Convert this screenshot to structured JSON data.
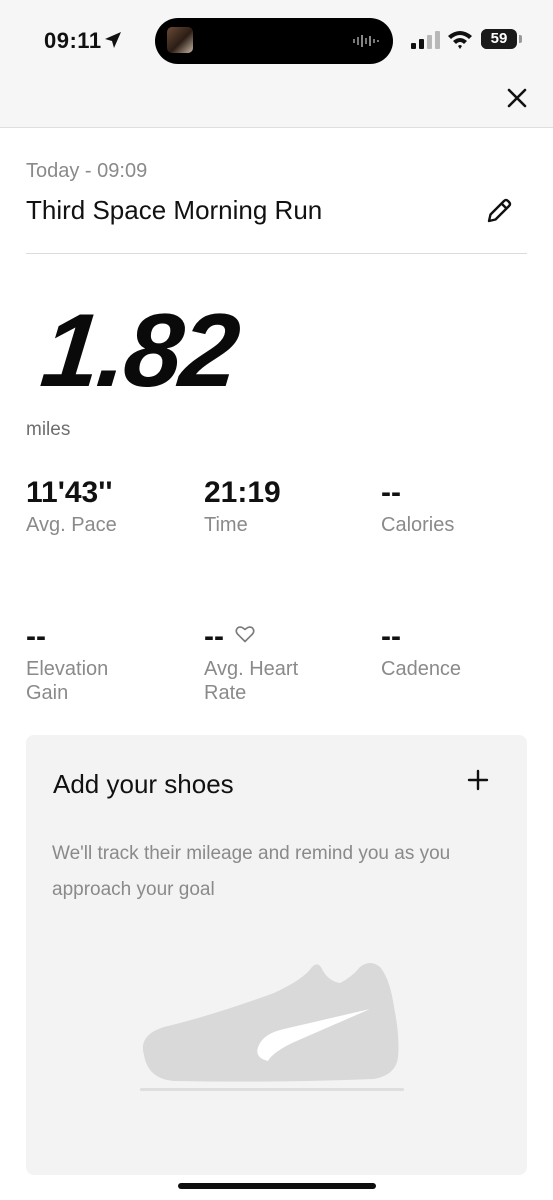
{
  "status_bar": {
    "time": "09:11",
    "battery": "59",
    "battery_level": 0.59,
    "icons": [
      "location-arrow-icon",
      "cellular-signal-icon",
      "wifi-icon",
      "battery-icon"
    ]
  },
  "header": {
    "close_icon": "close-icon"
  },
  "activity": {
    "date": "Today - 09:09",
    "title": "Third Space Morning Run",
    "edit_icon": "pencil-icon",
    "distance": "1.82",
    "distance_unit": "miles"
  },
  "stats": [
    {
      "value": "11'43''",
      "label": "Avg. Pace"
    },
    {
      "value": "21:19",
      "label": "Time"
    },
    {
      "value": "--",
      "label": "Calories"
    },
    {
      "value": "--",
      "label": "Elevation Gain"
    },
    {
      "value": "--",
      "label": "Avg. Heart Rate"
    },
    {
      "value": "--",
      "label": "Cadence"
    }
  ],
  "shoes": {
    "title": "Add your shoes",
    "add_icon": "plus-icon",
    "description": "We'll track their mileage and remind you as you approach your goal",
    "image_icon": "shoe-icon"
  },
  "colors": {
    "text": "#111111",
    "muted": "#8a8a8a",
    "card": "#f3f3f3",
    "shoe": "#d8d8d8"
  }
}
